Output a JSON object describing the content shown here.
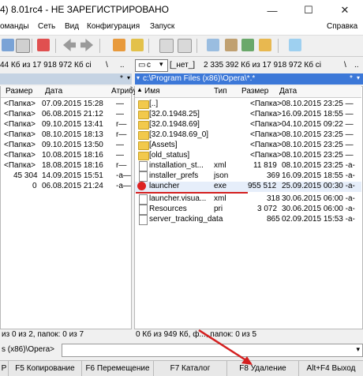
{
  "window": {
    "title": "4) 8.01rc4 - НЕ ЗАРЕГИСТРИРОВАНО",
    "minimize_glyph": "—",
    "maximize_glyph": "☐",
    "close_glyph": "✕"
  },
  "menu": {
    "items": [
      "оманды",
      "Сеть",
      "Вид",
      "Конфигурация",
      "Запуск"
    ],
    "help": "Справка"
  },
  "left": {
    "drive_info": "44 Кб из 17 918 972 Кб сі",
    "backslash": "\\",
    "dotdot": "..",
    "filter": "*",
    "headers": {
      "size": "Размер",
      "date": "Дата",
      "attr": "Атрибу"
    },
    "rows": [
      {
        "size": "<Папка>",
        "date": "07.09.2015 15:28",
        "attr": "—"
      },
      {
        "size": "<Папка>",
        "date": "06.08.2015 21:12",
        "attr": "—"
      },
      {
        "size": "<Папка>",
        "date": "09.10.2015 13:41",
        "attr": "r—"
      },
      {
        "size": "<Папка>",
        "date": "08.10.2015 18:13",
        "attr": "r—"
      },
      {
        "size": "<Папка>",
        "date": "09.10.2015 13:50",
        "attr": "—"
      },
      {
        "size": "<Папка>",
        "date": "10.08.2015 18:16",
        "attr": "—"
      },
      {
        "size": "<Папка>",
        "date": "18.08.2015 18:16",
        "attr": "r—"
      },
      {
        "size": "45 304",
        "date": "14.09.2015 15:51",
        "attr": "-a—"
      },
      {
        "size": "0",
        "date": "06.08.2015 21:24",
        "attr": "-a—"
      }
    ],
    "status": "из 0 из 2, папок: 0 из 7"
  },
  "right": {
    "drive_letter": "c",
    "drive_label": "[_нет_]",
    "drive_info": "2 335 392 Кб из 17 918 972 Кб сі",
    "backslash": "\\",
    "dotdot": "..",
    "path": "c:\\Program Files (x86)\\Opera\\*.*",
    "filter": "*",
    "headers": {
      "name": "Имя",
      "type": "Тип",
      "size": "Размер",
      "date": "Дата"
    },
    "rows": [
      {
        "name": "[..]",
        "type": "",
        "size": "<Папка>",
        "date": "08.10.2015 23:25 —",
        "icon": "up"
      },
      {
        "name": "[32.0.1948.25]",
        "type": "",
        "size": "<Папка>",
        "date": "16.09.2015 18:55 —",
        "icon": "folder"
      },
      {
        "name": "[32.0.1948.69]",
        "type": "",
        "size": "<Папка>",
        "date": "04.10.2015 09:22 —",
        "icon": "folder"
      },
      {
        "name": "[32.0.1948.69_0]",
        "type": "",
        "size": "<Папка>",
        "date": "08.10.2015 23:25 —",
        "icon": "folder"
      },
      {
        "name": "[Assets]",
        "type": "",
        "size": "<Папка>",
        "date": "08.10.2015 23:25 —",
        "icon": "folder"
      },
      {
        "name": "[old_status]",
        "type": "",
        "size": "<Папка>",
        "date": "08.10.2015 23:25 —",
        "icon": "folder"
      },
      {
        "name": "installation_st...",
        "type": "xml",
        "size": "11 819",
        "date": "08.10.2015 23:25 -a-",
        "icon": "file"
      },
      {
        "name": "installer_prefs",
        "type": "json",
        "size": "369",
        "date": "16.09.2015 18:55 -a-",
        "icon": "file"
      },
      {
        "name": "launcher",
        "type": "exe",
        "size": "955 512",
        "date": "25.09.2015 00:30 -a-",
        "icon": "opera"
      },
      {
        "name": "launcher.visua...",
        "type": "xml",
        "size": "318",
        "date": "30.06.2015 06:00 -a-",
        "icon": "file"
      },
      {
        "name": "Resources",
        "type": "pri",
        "size": "3 072",
        "date": "30.06.2015 06:00 -a-",
        "icon": "file"
      },
      {
        "name": "server_tracking_data",
        "type": "",
        "size": "865",
        "date": "02.09.2015 15:53 -a-",
        "icon": "file"
      }
    ],
    "status": "0 Кб из 949 Кб, ф..., папок: 0 из 5"
  },
  "cmdline": {
    "path": "s (x86)\\Opera>"
  },
  "fkeys": [
    "F5 Копирование",
    "F6 Перемещение",
    "F7 Каталог",
    "F8 Удаление",
    "Alt+F4 Выход"
  ],
  "fkey_lead": "Р",
  "colors": {
    "path_active": "#3c78d8",
    "path_inactive": "#c5d3e3",
    "annotation": "#d42020"
  }
}
